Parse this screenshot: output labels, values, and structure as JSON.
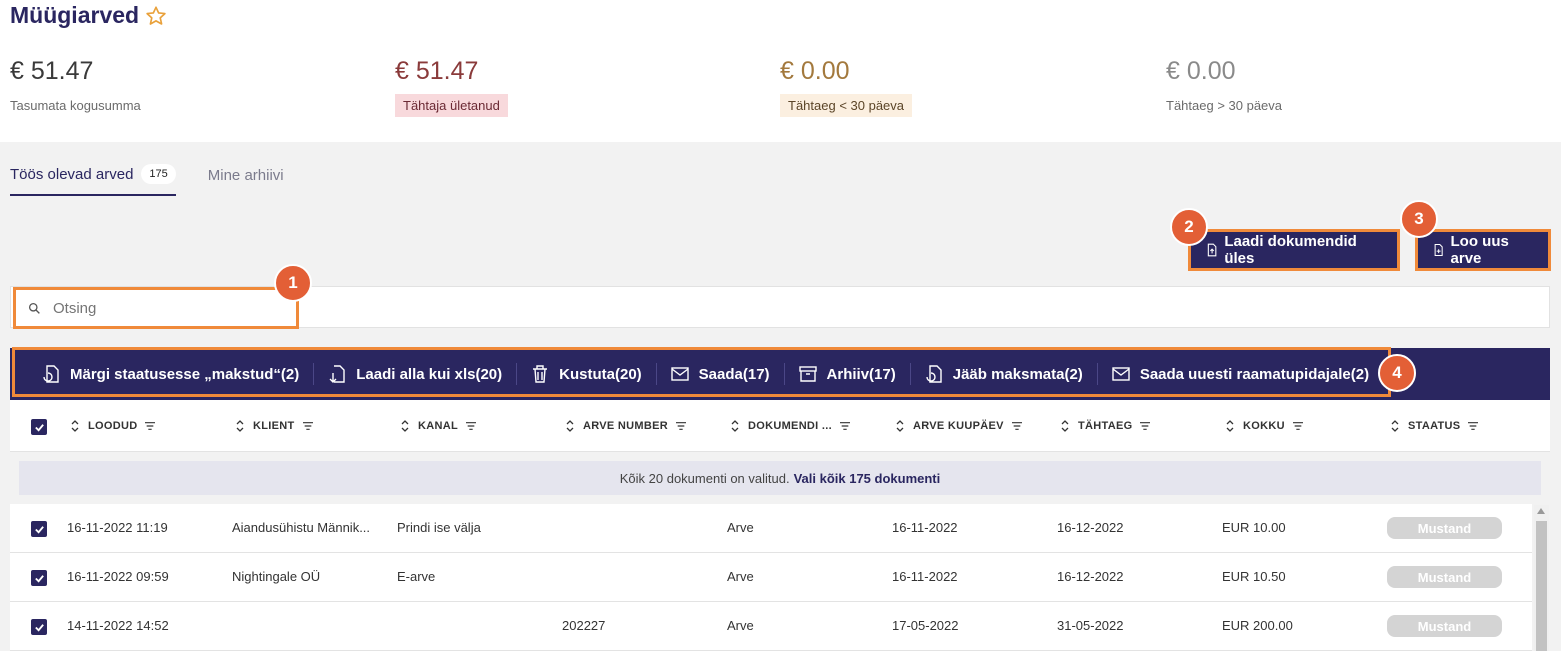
{
  "page": {
    "title": "Müügiarved",
    "star_icon": "star-icon",
    "accent": "#2a2660",
    "highlight": "#f08a3a"
  },
  "summary": [
    {
      "amount": "€ 51.47",
      "label": "Tasumata kogusumma",
      "color": "#3a3a3a"
    },
    {
      "amount": "€ 51.47",
      "label": "Tähtaja ületanud",
      "color": "#8a3a3a"
    },
    {
      "amount": "€ 0.00",
      "label": "Tähtaeg < 30 päeva",
      "color": "#a3793d"
    },
    {
      "amount": "€ 0.00",
      "label": "Tähtaeg > 30 päeva",
      "color": "#8a8a8a"
    }
  ],
  "tabs": [
    {
      "label": "Töös olevad arved",
      "count": "175"
    },
    {
      "label": "Mine arhiivi"
    }
  ],
  "buttons": {
    "upload": "Laadi dokumendid üles",
    "create": "Loo uus arve"
  },
  "markers": [
    "1",
    "2",
    "3",
    "4"
  ],
  "search": {
    "placeholder": "Otsing"
  },
  "actions": [
    {
      "label": "Märgi staatusesse „makstud“(2)",
      "icon": "mark-paid-icon"
    },
    {
      "label": "Laadi alla kui xls(20)",
      "icon": "download-icon"
    },
    {
      "label": "Kustuta(20)",
      "icon": "trash-icon"
    },
    {
      "label": "Saada(17)",
      "icon": "mail-icon"
    },
    {
      "label": "Arhiiv(17)",
      "icon": "archive-icon"
    },
    {
      "label": "Jääb maksmata(2)",
      "icon": "unpaid-icon"
    },
    {
      "label": "Saada uuesti raamatupidajale(2)",
      "icon": "mail-icon"
    }
  ],
  "columns": [
    "LOODUD",
    "KLIENT",
    "KANAL",
    "ARVE NUMBER",
    "DOKUMENDI ...",
    "ARVE KUUPÄEV",
    "TÄHTAEG",
    "KOKKU",
    "STAATUS"
  ],
  "selection": {
    "text": "Kõik 20 dokumenti on valitud.",
    "link": "Vali kõik 175 dokumenti"
  },
  "rows": [
    {
      "created": "16-11-2022 11:19",
      "client": "Aiandusühistu Männik...",
      "channel": "Prindi ise välja",
      "number": "",
      "doc": "Arve",
      "date": "16-11-2022",
      "due": "16-12-2022",
      "total": "EUR 10.00",
      "status": "Mustand"
    },
    {
      "created": "16-11-2022 09:59",
      "client": "Nightingale OÜ",
      "channel": "E-arve",
      "number": "",
      "doc": "Arve",
      "date": "16-11-2022",
      "due": "16-12-2022",
      "total": "EUR 10.50",
      "status": "Mustand"
    },
    {
      "created": "14-11-2022 14:52",
      "client": "",
      "channel": "",
      "number": "202227",
      "doc": "Arve",
      "date": "17-05-2022",
      "due": "31-05-2022",
      "total": "EUR 200.00",
      "status": "Mustand"
    }
  ]
}
